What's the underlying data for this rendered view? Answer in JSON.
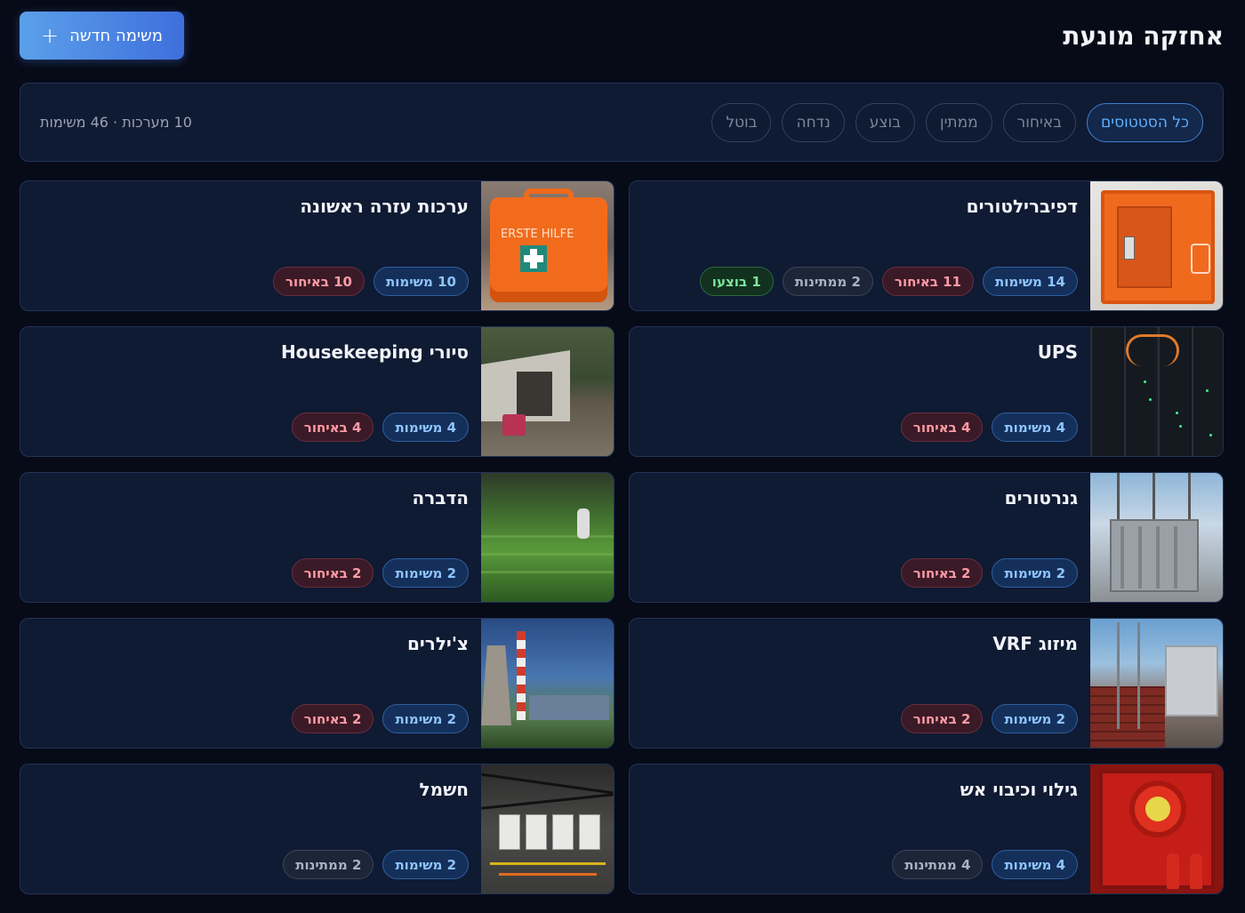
{
  "header": {
    "title": "אחזקה מונעת",
    "new_task_label": "משימה חדשה"
  },
  "filters": {
    "chips": [
      {
        "label": "כל הסטטוסים",
        "active": true
      },
      {
        "label": "באיחור"
      },
      {
        "label": "ממתין"
      },
      {
        "label": "בוצע"
      },
      {
        "label": "נדחה"
      },
      {
        "label": "בוטל"
      }
    ],
    "summary": "10 מערכות · 46 משימות"
  },
  "systems": [
    {
      "title": "דפיברילטורים",
      "badges": [
        "14 משימות",
        "11 באיחור",
        "2 ממתינות",
        "1 בוצעו"
      ]
    },
    {
      "title": "ערכות עזרה ראשונה",
      "badges": [
        "10 משימות",
        "10 באיחור"
      ]
    },
    {
      "title": "UPS",
      "badges": [
        "4 משימות",
        "4 באיחור"
      ]
    },
    {
      "title": "סיורי Housekeeping",
      "badges": [
        "4 משימות",
        "4 באיחור"
      ]
    },
    {
      "title": "גנרטורים",
      "badges": [
        "2 משימות",
        "2 באיחור"
      ]
    },
    {
      "title": "הדברה",
      "badges": [
        "2 משימות",
        "2 באיחור"
      ]
    },
    {
      "title": "מיזוג VRF",
      "badges": [
        "2 משימות",
        "2 באיחור"
      ]
    },
    {
      "title": "צ'ילרים",
      "badges": [
        "2 משימות",
        "2 באיחור"
      ]
    },
    {
      "title": "גילוי וכיבוי אש",
      "badges": [
        "4 משימות",
        "4 ממתינות"
      ]
    },
    {
      "title": "חשמל",
      "badges": [
        "2 משימות",
        "2 ממתינות"
      ]
    }
  ],
  "kit_text": "ERSTE HILFE"
}
